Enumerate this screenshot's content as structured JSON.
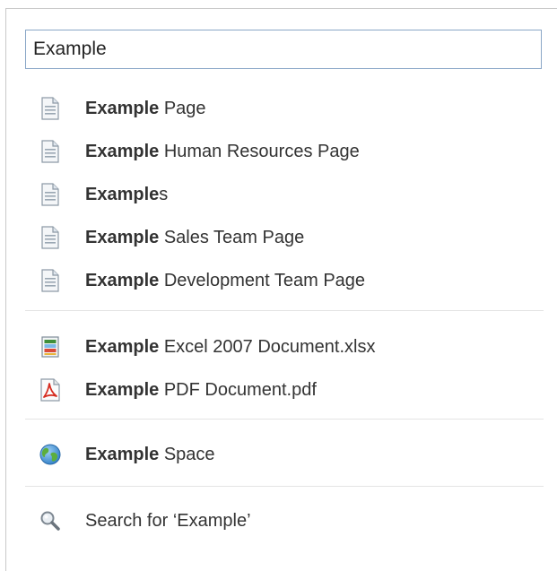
{
  "search": {
    "value": "Example"
  },
  "groups": [
    {
      "items": [
        {
          "icon": "page-icon",
          "bold": "Example",
          "rest": " Page"
        },
        {
          "icon": "page-icon",
          "bold": "Example",
          "rest": " Human Resources Page"
        },
        {
          "icon": "page-icon",
          "bold": "Example",
          "rest": "s"
        },
        {
          "icon": "page-icon",
          "bold": "Example",
          "rest": " Sales Team Page"
        },
        {
          "icon": "page-icon",
          "bold": "Example",
          "rest": " Development Team Page"
        }
      ]
    },
    {
      "items": [
        {
          "icon": "excel-file-icon",
          "bold": "Example",
          "rest": " Excel 2007 Document.xlsx"
        },
        {
          "icon": "pdf-file-icon",
          "bold": "Example",
          "rest": " PDF Document.pdf"
        }
      ]
    },
    {
      "items": [
        {
          "icon": "globe-icon",
          "bold": "Example",
          "rest": " Space"
        }
      ]
    },
    {
      "items": [
        {
          "icon": "magnifier-icon",
          "bold": "",
          "rest": "Search for ‘Example’"
        }
      ]
    }
  ],
  "colors": {
    "border": "#c9c9c9",
    "input_border": "#8aa7c7",
    "divider": "#e3e3e3",
    "text": "#333333"
  }
}
